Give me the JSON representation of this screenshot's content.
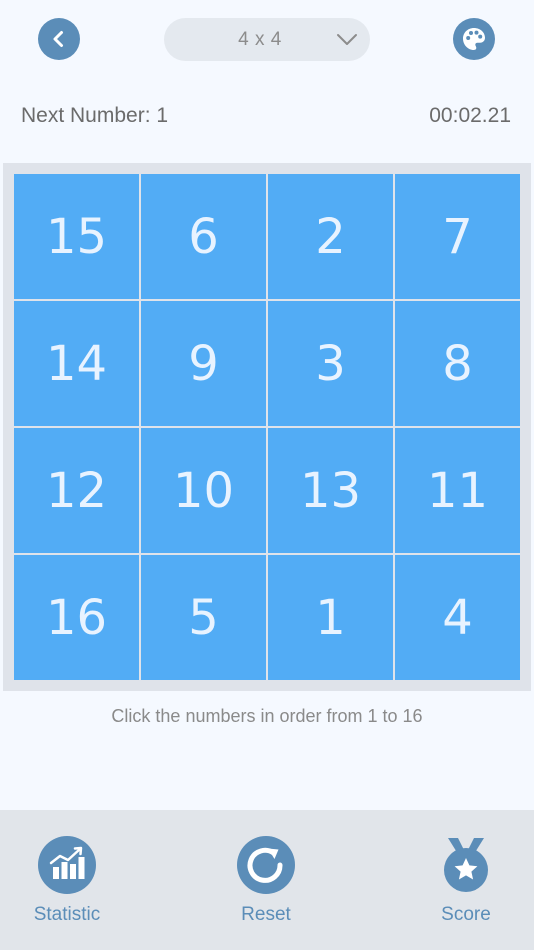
{
  "header": {
    "back_icon": "chevron-left-icon",
    "grid_size": {
      "selected": "4 x 4"
    },
    "theme_icon": "palette-icon"
  },
  "status": {
    "next_number": "Next Number: 1",
    "timer": "00:02.21"
  },
  "board": {
    "cells": [
      "15",
      "6",
      "2",
      "7",
      "14",
      "9",
      "3",
      "8",
      "12",
      "10",
      "13",
      "11",
      "16",
      "5",
      "1",
      "4"
    ]
  },
  "hint": "Click the numbers in order from 1 to 16",
  "tabs": {
    "statistic": "Statistic",
    "reset": "Reset",
    "score": "Score"
  },
  "colors": {
    "accent": "#5b8db8",
    "tile": "#52acf5",
    "background": "#f5f9ff",
    "bottom_bar": "#e1e5ea"
  }
}
